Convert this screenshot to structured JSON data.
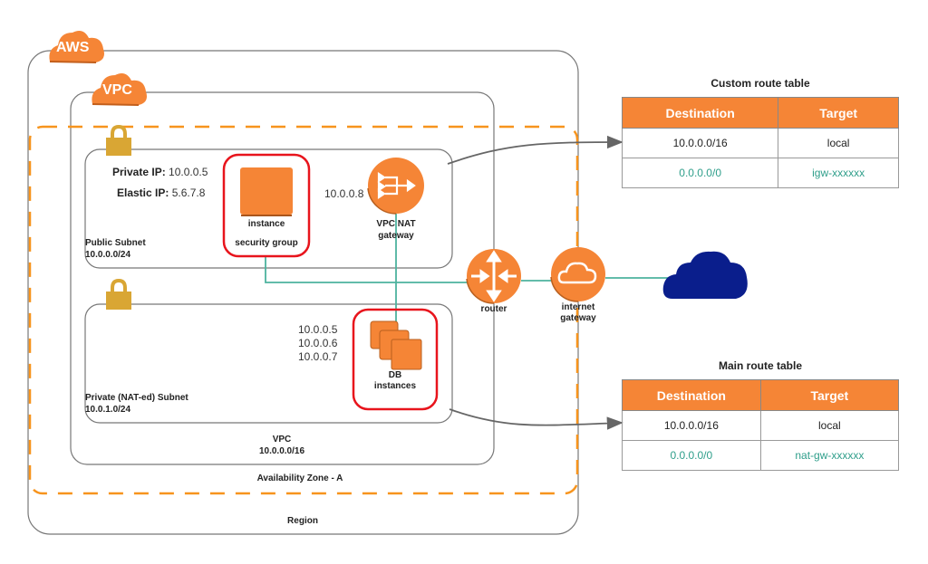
{
  "diagram": {
    "aws_badge": "AWS",
    "vpc_badge": "VPC",
    "region_label": "Region",
    "availability_zone_label": "Availability Zone - A",
    "vpc": {
      "name": "VPC",
      "cidr": "10.0.0.0/16"
    },
    "public_subnet": {
      "name": "Public Subnet",
      "cidr": "10.0.0.0/24",
      "private_ip_label": "Private IP:",
      "private_ip": "10.0.0.5",
      "elastic_ip_label": "Elastic IP:",
      "elastic_ip": "5.6.7.8",
      "instance_label": "instance",
      "security_group_label": "security group",
      "nat_ip": "10.0.0.8",
      "nat_label_line1": "VPC NAT",
      "nat_label_line2": "gateway"
    },
    "private_subnet": {
      "name": "Private (NAT-ed) Subnet",
      "cidr": "10.0.1.0/24",
      "db_ips": [
        "10.0.0.5",
        "10.0.0.6",
        "10.0.0.7"
      ],
      "db_label_line1": "DB",
      "db_label_line2": "instances"
    },
    "router_label": "router",
    "igw_label_line1": "internet",
    "igw_label_line2": "gateway",
    "icons": {
      "aws": "cloud-badge-icon",
      "vpc": "cloud-badge-icon",
      "lock": "lock-icon",
      "instance": "ec2-instance-icon",
      "nat": "nat-gateway-icon",
      "router": "router-icon",
      "igw": "internet-gateway-icon",
      "internet": "internet-cloud-icon",
      "db": "db-instances-icon"
    },
    "colors": {
      "aws_orange": "#f58536",
      "lock_gold": "#d9a634",
      "internet_cloud": "#0a1e8c",
      "connection_line": "#4db39e",
      "security_group_border": "#e8141c",
      "route_green": "#2e9e8a"
    }
  },
  "custom_route_table": {
    "title": "Custom route table",
    "headers": [
      "Destination",
      "Target"
    ],
    "rows": [
      {
        "destination": "10.0.0.0/16",
        "target": "local"
      },
      {
        "destination": "0.0.0.0/0",
        "target": "igw-xxxxxx"
      }
    ]
  },
  "main_route_table": {
    "title": "Main route table",
    "headers": [
      "Destination",
      "Target"
    ],
    "rows": [
      {
        "destination": "10.0.0.0/16",
        "target": "local"
      },
      {
        "destination": "0.0.0.0/0",
        "target": "nat-gw-xxxxxx"
      }
    ]
  }
}
